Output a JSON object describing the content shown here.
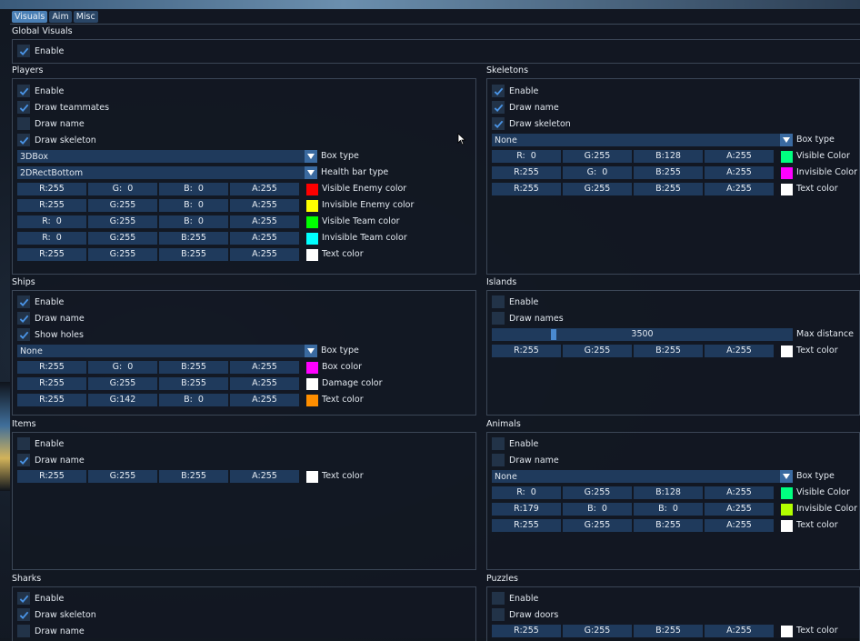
{
  "tabs": [
    "Visuals",
    "Aim",
    "Misc"
  ],
  "global": {
    "title": "Global Visuals",
    "enable": "Enable"
  },
  "players": {
    "title": "Players",
    "enable": "Enable",
    "draw_teammates": "Draw teammates",
    "draw_name": "Draw name",
    "draw_skeleton": "Draw skeleton",
    "box_type_value": "3DBox",
    "box_type_label": "Box type",
    "health_bar_value": "2DRectBottom",
    "health_bar_label": "Health bar type",
    "rows": [
      {
        "r": "R:255",
        "g": "G:  0",
        "b": "B:  0",
        "a": "A:255",
        "label": "Visible Enemy color",
        "color": "#ff0000"
      },
      {
        "r": "R:255",
        "g": "G:255",
        "b": "B:  0",
        "a": "A:255",
        "label": "Invisible Enemy color",
        "color": "#ffff00"
      },
      {
        "r": "R:  0",
        "g": "G:255",
        "b": "B:  0",
        "a": "A:255",
        "label": "Visible Team color",
        "color": "#00ff00"
      },
      {
        "r": "R:  0",
        "g": "G:255",
        "b": "B:255",
        "a": "A:255",
        "label": "Invisible Team color",
        "color": "#00ffff"
      },
      {
        "r": "R:255",
        "g": "G:255",
        "b": "B:255",
        "a": "A:255",
        "label": "Text color",
        "color": "#ffffff"
      }
    ]
  },
  "skeletons": {
    "title": "Skeletons",
    "enable": "Enable",
    "draw_name": "Draw name",
    "draw_skeleton": "Draw skeleton",
    "box_type_value": "None",
    "box_type_label": "Box type",
    "rows": [
      {
        "r": "R:  0",
        "g": "G:255",
        "b": "B:128",
        "a": "A:255",
        "label": "Visible Color",
        "color": "#00ff80"
      },
      {
        "r": "R:255",
        "g": "G:  0",
        "b": "B:255",
        "a": "A:255",
        "label": "Invisible Color",
        "color": "#ff00ff"
      },
      {
        "r": "R:255",
        "g": "G:255",
        "b": "B:255",
        "a": "A:255",
        "label": "Text color",
        "color": "#ffffff"
      }
    ]
  },
  "ships": {
    "title": "Ships",
    "enable": "Enable",
    "draw_name": "Draw name",
    "show_holes": "Show holes",
    "box_type_value": "None",
    "box_type_label": "Box type",
    "rows": [
      {
        "r": "R:255",
        "g": "G:  0",
        "b": "B:255",
        "a": "A:255",
        "label": "Box color",
        "color": "#ff00ff"
      },
      {
        "r": "R:255",
        "g": "G:255",
        "b": "B:255",
        "a": "A:255",
        "label": "Damage color",
        "color": "#ffffff"
      },
      {
        "r": "R:255",
        "g": "G:142",
        "b": "B:  0",
        "a": "A:255",
        "label": "Text color",
        "color": "#ff8e00"
      }
    ]
  },
  "islands": {
    "title": "Islands",
    "enable": "Enable",
    "draw_names": "Draw names",
    "max_distance_value": "3500",
    "max_distance_fraction": 0.2,
    "max_distance_label": "Max distance",
    "row": {
      "r": "R:255",
      "g": "G:255",
      "b": "B:255",
      "a": "A:255",
      "label": "Text color",
      "color": "#ffffff"
    }
  },
  "items": {
    "title": "Items",
    "enable": "Enable",
    "draw_name": "Draw name",
    "row": {
      "r": "R:255",
      "g": "G:255",
      "b": "B:255",
      "a": "A:255",
      "label": "Text color",
      "color": "#ffffff"
    }
  },
  "animals": {
    "title": "Animals",
    "enable": "Enable",
    "draw_name": "Draw name",
    "box_type_value": "None",
    "box_type_label": "Box type",
    "rows": [
      {
        "r": "R:  0",
        "g": "G:255",
        "b": "B:128",
        "a": "A:255",
        "label": "Visible Color",
        "color": "#00ff80"
      },
      {
        "r": "R:179",
        "g": "B:  0",
        "b": "B:  0",
        "a": "A:255",
        "label": "Invisible Color",
        "color": "#b3ff00"
      },
      {
        "r": "R:255",
        "g": "G:255",
        "b": "B:255",
        "a": "A:255",
        "label": "Text color",
        "color": "#ffffff"
      }
    ]
  },
  "sharks": {
    "title": "Sharks",
    "enable": "Enable",
    "draw_skeleton": "Draw skeleton",
    "draw_name": "Draw name"
  },
  "puzzles": {
    "title": "Puzzles",
    "enable": "Enable",
    "draw_doors": "Draw doors",
    "row": {
      "r": "R:255",
      "g": "G:255",
      "b": "B:255",
      "a": "A:255",
      "label": "Text color",
      "color": "#ffffff"
    }
  }
}
